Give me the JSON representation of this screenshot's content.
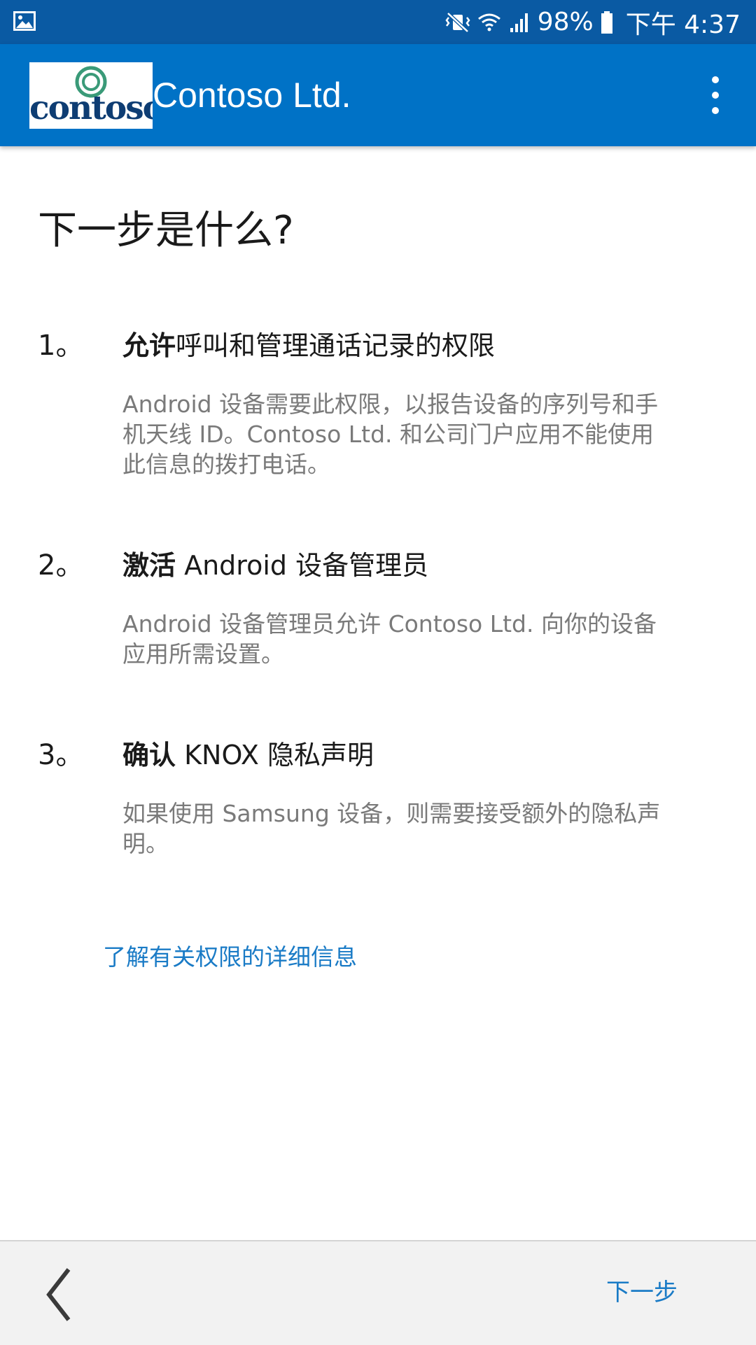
{
  "status_bar": {
    "battery_percent": "98%",
    "time": "下午 4:37",
    "icons": [
      "gallery-icon",
      "vibrate-mute-icon",
      "wifi-icon",
      "signal-icon",
      "battery-icon"
    ]
  },
  "app_bar": {
    "logo_text": "contoso",
    "title": "Contoso Ltd.",
    "menu_icon": "more-vert-icon"
  },
  "page": {
    "title": "下一步是什么?",
    "steps": [
      {
        "number": "1。",
        "title_bold": "允许",
        "title_rest": "呼叫和管理通话记录的权限",
        "description": "Android 设备需要此权限，以报告设备的序列号和手机天线 ID。Contoso Ltd. 和公司门户应用不能使用此信息的拨打电话。"
      },
      {
        "number": "2。",
        "title_bold": "激活",
        "title_rest": " Android 设备管理员",
        "description": "Android 设备管理员允许 Contoso Ltd. 向你的设备应用所需设置。"
      },
      {
        "number": "3。",
        "title_bold": "确认",
        "title_rest": " KNOX 隐私声明",
        "description": "如果使用 Samsung 设备，则需要接受额外的隐私声明。"
      }
    ],
    "learn_more_link": "了解有关权限的详细信息"
  },
  "bottom_bar": {
    "back_icon": "chevron-left-icon",
    "next_label": "下一步"
  },
  "colors": {
    "status_bar": "#0a5aa3",
    "app_bar": "#0072c6",
    "link": "#1a7bc6",
    "description_text": "#7a7a7a",
    "logo_ring": "#3a9a78",
    "logo_text": "#0e3d73"
  }
}
